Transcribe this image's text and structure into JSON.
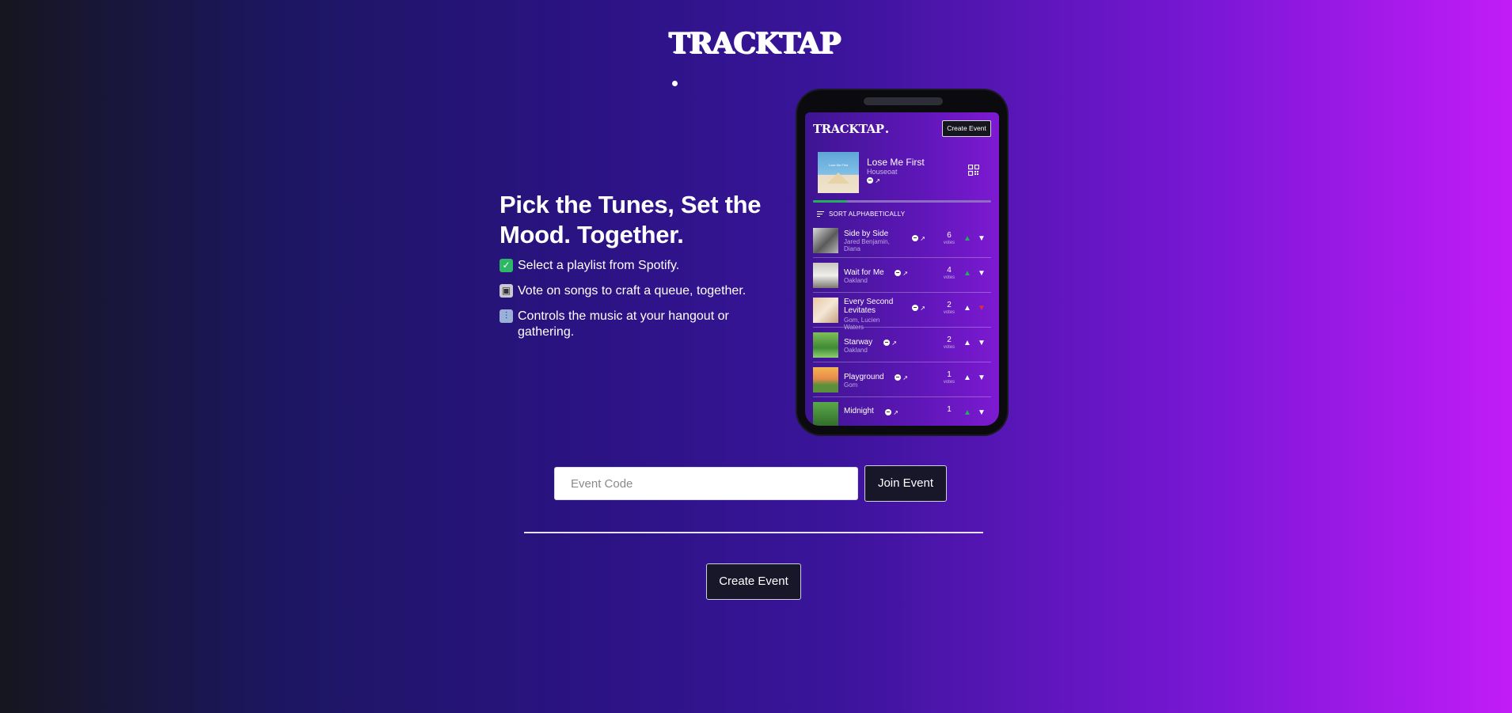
{
  "brand": {
    "name": "TRACKTAP"
  },
  "hero": {
    "headline": "Pick the Tunes, Set the Mood. Together.",
    "features": [
      {
        "icon": "check-emoji",
        "text": "Select a playlist from Spotify."
      },
      {
        "icon": "ballot-box-emoji",
        "text": "Vote on songs to craft a queue, together."
      },
      {
        "icon": "control-knobs-emoji",
        "text": "Controls the music at your hangout or gathering."
      }
    ]
  },
  "phone": {
    "app_logo": "TRACKTAP",
    "create_event_label": "Create Event",
    "now_playing": {
      "title": "Lose Me First",
      "artist": "Houseoat",
      "art_text": "Lose Me First",
      "progress": 0.19
    },
    "sort_label": "SORT ALPHABETICALLY",
    "votes_label": "votes",
    "tracks": [
      {
        "title": "Side by Side",
        "artist": "Jared Benjamin, Diana",
        "votes": "6",
        "up": "green",
        "down": "white"
      },
      {
        "title": "Wait for Me",
        "artist": "Oakland",
        "votes": "4",
        "up": "green",
        "down": "white"
      },
      {
        "title": "Every Second Levitates",
        "artist": "Gom, Lucien Waters",
        "votes": "2",
        "up": "white",
        "down": "red"
      },
      {
        "title": "Starway",
        "artist": "Oakland",
        "votes": "2",
        "up": "white",
        "down": "white"
      },
      {
        "title": "Playground",
        "artist": "Gom",
        "votes": "1",
        "up": "white",
        "down": "white"
      },
      {
        "title": "Midnight",
        "artist": "",
        "votes": "1",
        "up": "green",
        "down": "white"
      }
    ]
  },
  "form": {
    "event_code_placeholder": "Event Code",
    "event_code_value": "",
    "join_label": "Join Event",
    "create_label": "Create Event"
  },
  "colors": {
    "gradient_start": "#16161f",
    "gradient_mid": "#2a1382",
    "gradient_end": "#c21cf6",
    "button_bg": "#18172a",
    "vote_up_active": "#22b05d",
    "vote_down_active": "#e0303a"
  }
}
